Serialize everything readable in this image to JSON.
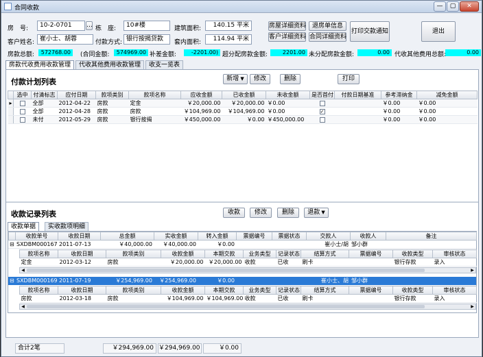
{
  "window": {
    "title": "合同收款",
    "min": "—",
    "max": "▢",
    "close": "✕"
  },
  "info": {
    "room_label": "房　号:",
    "room_value": "10-2-0701",
    "building_label": "栋　座:",
    "building_value": "10#楼",
    "area_label": "建筑面积:",
    "area_value": "140.15 平米",
    "customer_label": "客户姓名:",
    "customer_value": "崔小士、胡蓉",
    "payment_label": "付款方式:",
    "payment_value": "银行按揭贷款",
    "inner_area_label": "套内面积:",
    "inner_area_value": "114.94 平米"
  },
  "actions": {
    "house_detail": "房屋详细资料",
    "refund_info": "退房单信息",
    "customer_detail": "客户详细资料",
    "contract_detail": "合同详细资料",
    "print_notice": "打印交款通知",
    "exit": "退出"
  },
  "summary": {
    "total_label": "房款总额:",
    "total_value": "572768.00",
    "contract_label": "(合同金额:",
    "contract_value": "574969.00",
    "diff_label": "补差金额:",
    "diff_value": "-2201.00)",
    "overpay_label": "超分配房款金额:",
    "overpay_value": "2201.00",
    "unalloc_label": "未分配房款金额:",
    "unalloc_value": "0.00",
    "other_label": "代收其他费用总额:",
    "other_value": "0.00"
  },
  "main_tabs": [
    "房款代收费用收款管理",
    "代收其他费用收款管理",
    "收支一览表"
  ],
  "plan": {
    "title": "付款计划列表",
    "buttons": {
      "add": "新增",
      "edit": "修改",
      "delete": "删除",
      "print": "打印"
    },
    "columns": [
      "选中",
      "付清标志",
      "应付日期",
      "款项类别",
      "款项名称",
      "应收金额",
      "已收金额",
      "未收金额",
      "是否首付",
      "付款日期基准",
      "参考滞纳金",
      "减免金额"
    ],
    "rows": [
      {
        "sel": "",
        "flag": "全部",
        "date": "2012-04-22",
        "cat": "房款",
        "name": "定金",
        "due": "￥20,000.00",
        "paid": "￥20,000.00",
        "unpaid": "￥0.00",
        "first": "",
        "basis": "",
        "late": "￥0.00",
        "waive": "￥0.00"
      },
      {
        "sel": "",
        "flag": "全部",
        "date": "2012-04-28",
        "cat": "房款",
        "name": "房款",
        "due": "￥104,969.00",
        "paid": "￥104,969.00",
        "unpaid": "￥0.00",
        "first": "✓",
        "basis": "",
        "late": "￥0.00",
        "waive": "￥0.00"
      },
      {
        "sel": "",
        "flag": "未付",
        "date": "2012-05-29",
        "cat": "房款",
        "name": "银行按揭",
        "due": "￥450,000.00",
        "paid": "￥0.00",
        "unpaid": "￥450,000.00",
        "first": "",
        "basis": "",
        "late": "￥0.00",
        "waive": "￥0.00"
      }
    ]
  },
  "receipts": {
    "title": "收款记录列表",
    "buttons": {
      "collect": "收款",
      "edit": "修改",
      "delete": "删除",
      "refund": "退款"
    },
    "tabs": [
      "收款单据",
      "实收款项明细"
    ],
    "columns": [
      "收款单号",
      "收款日期",
      "总金额",
      "实收金额",
      "转入金额",
      "票据编号",
      "票据状态",
      "交款人",
      "收款人",
      "备注"
    ],
    "sub_columns": [
      "款项名称",
      "收款日期",
      "款项类别",
      "收款金额",
      "本期交款",
      "业务类型",
      "记录状态",
      "结算方式",
      "票据编号",
      "收款类型",
      "审核状态"
    ],
    "records": [
      {
        "no": "SXDBM0001677",
        "date": "2011-07-13",
        "total": "￥40,000.00",
        "actual": "￥40,000.00",
        "transfer": "￥0.00",
        "bill_no": "",
        "bill_status": "",
        "payer": "崔小士/胡",
        "receiver": "邹小群",
        "note": "",
        "detail": {
          "name": "定金",
          "date": "2012-03-12",
          "cat": "房款",
          "amount": "￥20,000.00",
          "period": "￥20,000.00",
          "biz": "收款",
          "status": "已收",
          "settle": "刷卡",
          "bill": "",
          "type": "银行存款",
          "audit": "录入"
        }
      },
      {
        "no": "SXDBM0001696",
        "date": "2011-07-19",
        "total": "￥254,969.00",
        "actual": "￥254,969.00",
        "transfer": "￥0.00",
        "bill_no": "",
        "bill_status": "",
        "payer": "崔小士、胡",
        "receiver": "邹小群",
        "note": "",
        "detail": {
          "name": "房款",
          "date": "2012-03-18",
          "cat": "房款",
          "amount": "￥104,969.00",
          "period": "￥104,969.00",
          "biz": "收款",
          "status": "已收",
          "settle": "刷卡",
          "bill": "",
          "type": "银行存款",
          "audit": "录入"
        }
      }
    ],
    "footer": {
      "count": "合计2笔",
      "total": "￥294,969.00",
      "actual": "￥294,969.00",
      "transfer": "￥0.00"
    }
  }
}
